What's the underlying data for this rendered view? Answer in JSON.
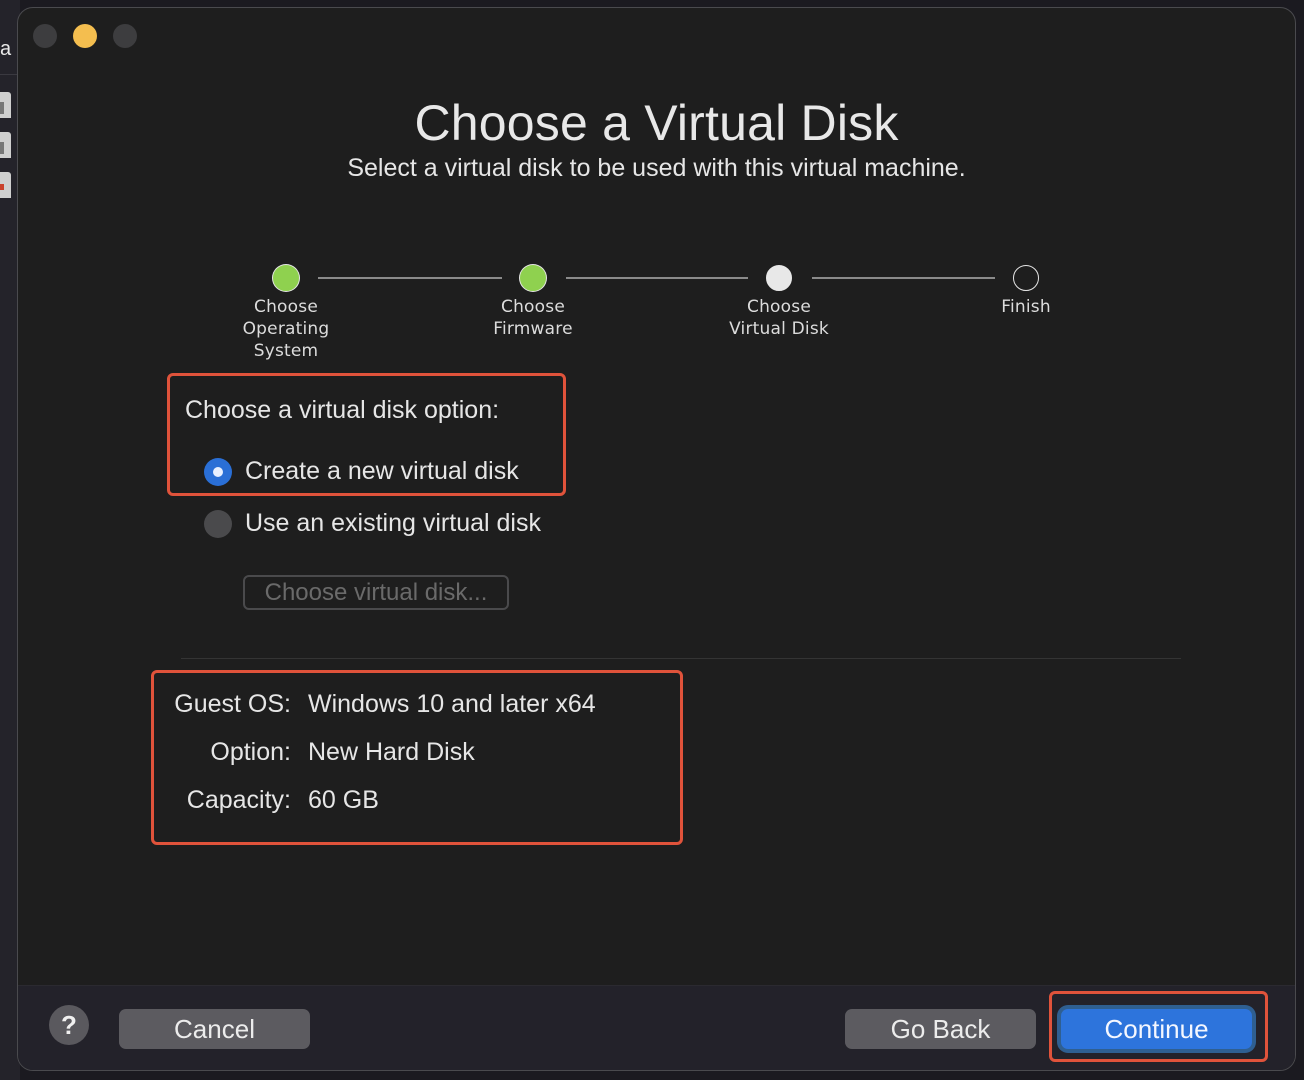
{
  "background_app": {
    "partial_text": "a"
  },
  "window": {
    "title": "Choose a Virtual Disk",
    "subtitle": "Select a virtual disk to be used with this virtual machine."
  },
  "steps": [
    {
      "label": "Choose Operating System",
      "state": "done"
    },
    {
      "label": "Choose Firmware",
      "state": "done"
    },
    {
      "label": "Choose Virtual Disk",
      "state": "current"
    },
    {
      "label": "Finish",
      "state": "todo"
    }
  ],
  "disk_option": {
    "prompt": "Choose a virtual disk option:",
    "options": [
      {
        "label": "Create a new virtual disk",
        "selected": true
      },
      {
        "label": "Use an existing virtual disk",
        "selected": false
      }
    ],
    "choose_button_label": "Choose virtual disk...",
    "choose_button_enabled": false
  },
  "summary": {
    "rows": [
      {
        "key": "Guest OS:",
        "value": "Windows 10 and later x64"
      },
      {
        "key": "Option:",
        "value": "New Hard Disk"
      },
      {
        "key": "Capacity:",
        "value": "60 GB"
      }
    ]
  },
  "footer": {
    "help_label": "?",
    "cancel_label": "Cancel",
    "back_label": "Go Back",
    "continue_label": "Continue"
  },
  "colors": {
    "step_done": "#8fd14f",
    "accent_blue": "#2d74dc",
    "highlight": "#e0533b",
    "minimize": "#f4be4f"
  }
}
